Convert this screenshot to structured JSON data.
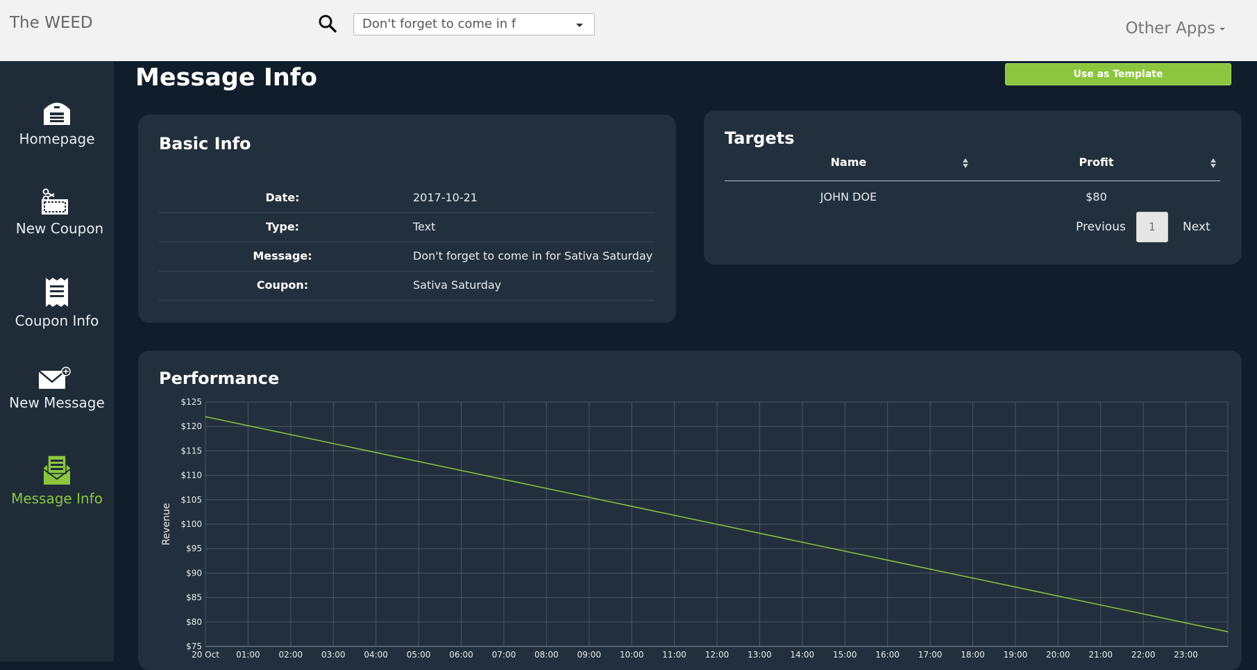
{
  "header": {
    "brand": "The WEED",
    "search_select_value": "Don't forget to come in f",
    "other_apps": "Other Apps"
  },
  "sidebar": {
    "items": [
      {
        "label": "Homepage",
        "icon": "homepage-icon"
      },
      {
        "label": "New Coupon",
        "icon": "coupon-scissors-icon"
      },
      {
        "label": "Coupon Info",
        "icon": "receipt-icon"
      },
      {
        "label": "New Message",
        "icon": "envelope-plus-icon"
      },
      {
        "label": "Message Info",
        "icon": "message-info-icon",
        "active": true
      }
    ]
  },
  "page": {
    "title": "Message Info",
    "template_button": "Use as Template"
  },
  "basic_info": {
    "title": "Basic Info",
    "rows": [
      {
        "label": "Date:",
        "value": "2017-10-21"
      },
      {
        "label": "Type:",
        "value": "Text"
      },
      {
        "label": "Message:",
        "value": "Don't forget to come in for Sativa Saturday"
      },
      {
        "label": "Coupon:",
        "value": "Sativa Saturday"
      }
    ]
  },
  "targets": {
    "title": "Targets",
    "columns": [
      "Name",
      "Profit"
    ],
    "rows": [
      {
        "name": "JOHN DOE",
        "profit": "$80"
      }
    ],
    "pager": {
      "previous": "Previous",
      "current": "1",
      "next": "Next"
    }
  },
  "performance": {
    "title": "Performance"
  },
  "colors": {
    "accent": "#8cc63f",
    "background": "#0f1e2a",
    "card": "#22303d",
    "sidebar": "#1f2c38"
  },
  "chart_data": {
    "type": "line",
    "title": "",
    "xlabel": "",
    "ylabel": "Revenue",
    "x_ticks": [
      "20 Oct",
      "01:00",
      "02:00",
      "03:00",
      "04:00",
      "05:00",
      "06:00",
      "07:00",
      "08:00",
      "09:00",
      "10:00",
      "11:00",
      "12:00",
      "13:00",
      "14:00",
      "15:00",
      "16:00",
      "17:00",
      "18:00",
      "19:00",
      "20:00",
      "21:00",
      "22:00",
      "23:00"
    ],
    "y_ticks": [
      "$75",
      "$80",
      "$85",
      "$90",
      "$95",
      "$100",
      "$105",
      "$110",
      "$115",
      "$120",
      "$125"
    ],
    "ylim": [
      75,
      125
    ],
    "xlim": [
      "2017-10-20 00:00",
      "2017-10-20 23:59"
    ],
    "grid": true,
    "series": [
      {
        "x": [
          "2017-10-20 00:00",
          "2017-10-20 23:59"
        ],
        "values": [
          122,
          78
        ],
        "color": "#8cc63f"
      }
    ]
  }
}
